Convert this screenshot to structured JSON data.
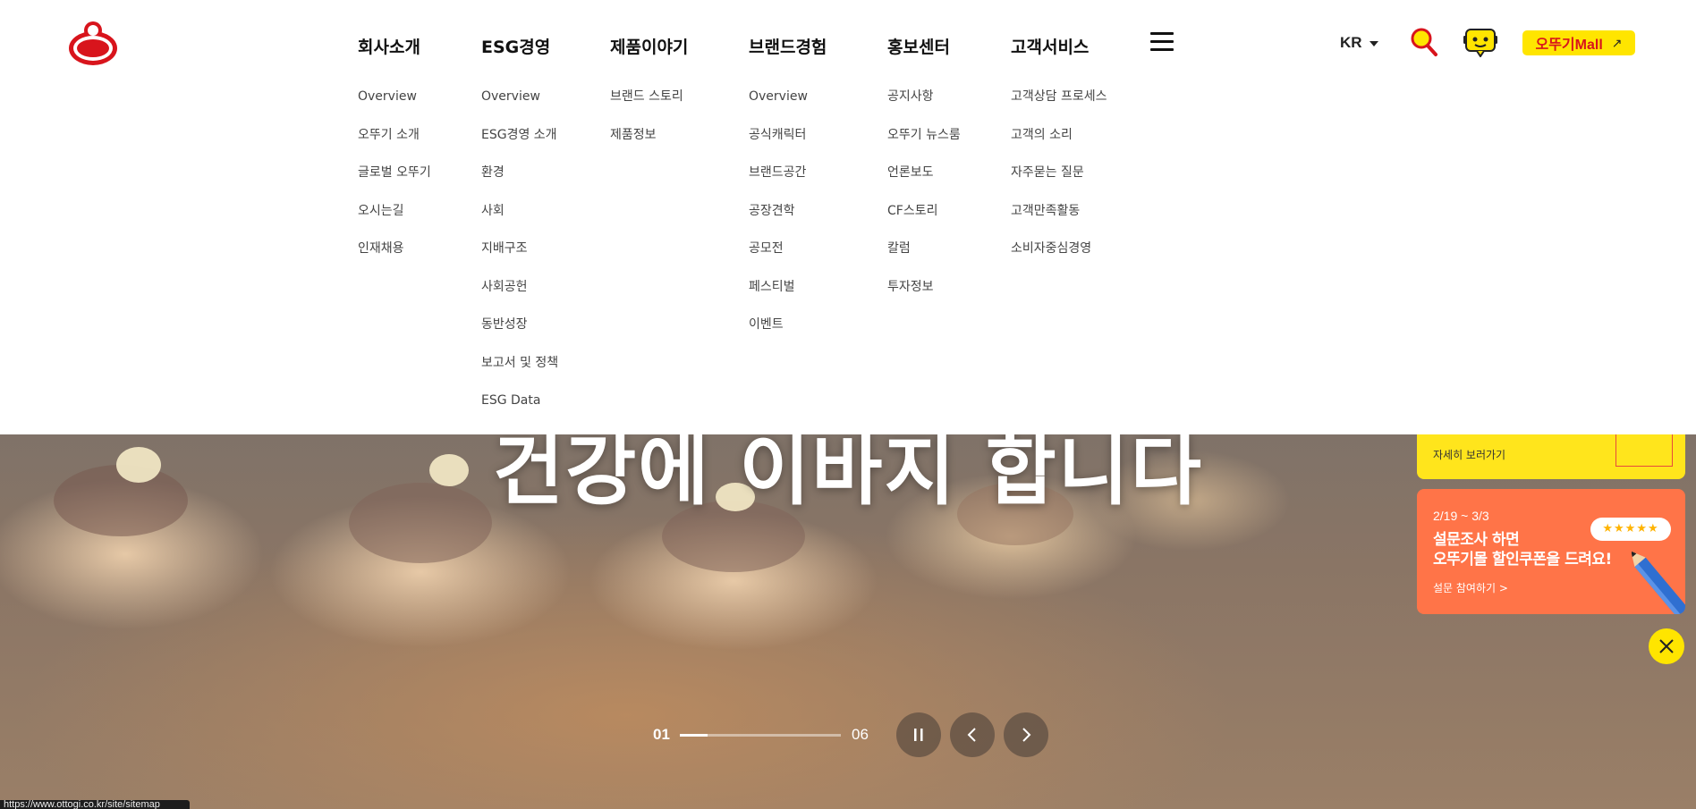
{
  "header": {
    "logo_text": "오뚜기",
    "nav": [
      {
        "label": "회사소개",
        "items": [
          "Overview",
          "오뚜기 소개",
          "글로벌 오뚜기",
          "오시는길",
          "인재채용"
        ]
      },
      {
        "label": "ESG경영",
        "items": [
          "Overview",
          "ESG경영 소개",
          "환경",
          "사회",
          "지배구조",
          "사회공헌",
          "동반성장",
          "보고서 및 정책",
          "ESG Data"
        ]
      },
      {
        "label": "제품이야기",
        "items": [
          "브랜드 스토리",
          "제품정보"
        ]
      },
      {
        "label": "브랜드경험",
        "items": [
          "Overview",
          "공식캐릭터",
          "브랜드공간",
          "공장견학",
          "공모전",
          "페스티벌",
          "이벤트"
        ]
      },
      {
        "label": "홍보센터",
        "items": [
          "공지사항",
          "오뚜기 뉴스룸",
          "언론보도",
          "CF스토리",
          "칼럼",
          "투자정보"
        ]
      },
      {
        "label": "고객서비스",
        "items": [
          "고객상담 프로세스",
          "고객의 소리",
          "자주묻는 질문",
          "고객만족활동",
          "소비자중심경영"
        ]
      }
    ],
    "lang": "KR",
    "mall_label": "오뚜기Mall",
    "mall_arrow": "↗",
    "icons": {
      "search": "search-icon",
      "chat": "chatbot-icon",
      "menu": "hamburger-icon"
    }
  },
  "hero": {
    "title": "건강에 이바지 합니다"
  },
  "side_banners": {
    "yellow": {
      "more_label": "자세히 보러가기"
    },
    "orange": {
      "date": "2/19 ~ 3/3",
      "headline_1": "설문조사 하면",
      "headline_2": "오뚜기몰 할인쿠폰을 드려요!",
      "link_label": "설문 참여하기 >",
      "stars": "★★★★★"
    }
  },
  "slider": {
    "current": "01",
    "total": "06",
    "progress": 0.17
  },
  "status_bar": {
    "url": "https://www.ottogi.co.kr/site/sitemap"
  },
  "colors": {
    "brand_red": "#d8141c",
    "brand_yellow": "#ffe500",
    "banner_orange": "#ff7448"
  }
}
